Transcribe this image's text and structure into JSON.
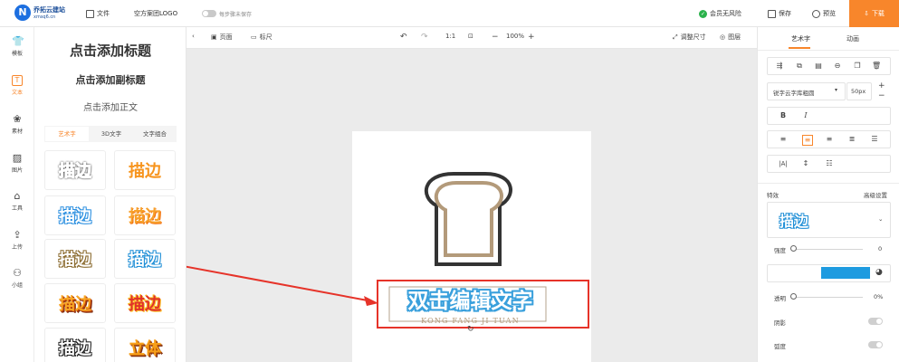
{
  "topbar": {
    "logo_letter": "N",
    "brand_name": "乔拓云建站",
    "brand_domain": "xmsq6.cn",
    "file_label": "文件",
    "blank_template_label": "空方案团LOGO",
    "save_cloud_label": "每步骤未保存",
    "member_label": "会员无风险",
    "save_label": "保存",
    "preview_label": "预览",
    "download_label": "下载"
  },
  "rail": {
    "items": [
      {
        "label": "模板",
        "icon": "shirt-icon",
        "glyph": "👕"
      },
      {
        "label": "文本",
        "icon": "text-icon",
        "glyph": "T"
      },
      {
        "label": "素材",
        "icon": "material-icon",
        "glyph": "❀"
      },
      {
        "label": "图片",
        "icon": "image-icon",
        "glyph": "▨"
      },
      {
        "label": "工具",
        "icon": "toolbox-icon",
        "glyph": "⌂"
      },
      {
        "label": "上传",
        "icon": "upload-icon",
        "glyph": "⇪"
      },
      {
        "label": "小组",
        "icon": "group-icon",
        "glyph": "⚇"
      }
    ]
  },
  "text_panel": {
    "add_title": "点击添加标题",
    "add_subtitle": "点击添加副标题",
    "add_body": "点击添加正文",
    "tabs": [
      "艺术字",
      "3D文字",
      "文字组合"
    ],
    "swatches": [
      {
        "text": "描边"
      },
      {
        "text": "描边"
      },
      {
        "text": "描边"
      },
      {
        "text": "描边"
      },
      {
        "text": "描边"
      },
      {
        "text": "描边"
      },
      {
        "text": "描边"
      },
      {
        "text": "描边"
      },
      {
        "text": "描边"
      },
      {
        "text": "立体"
      }
    ]
  },
  "canvas_toolbar": {
    "page_label": "页面",
    "ruler_label": "标尺",
    "ratio_label": "1:1",
    "zoom_label": "100%",
    "resize_label": "调整尺寸",
    "layers_label": "图层"
  },
  "canvas": {
    "main_text": "双击编辑文字",
    "sub_text": "KONG FANG JI TUAN",
    "colors": {
      "bread_outer": "#333333",
      "bread_inner": "#b39a7a",
      "highlight": "#e63329",
      "text_fill": "#ffffff",
      "text_stroke": "#3aa0dc"
    }
  },
  "right_panel": {
    "tabs": [
      "艺术字",
      "动画"
    ],
    "font_name": "锐字云字库粗圆",
    "font_size": "50px",
    "effects_label": "特效",
    "advanced_label": "高级设置",
    "preview_text": "描边",
    "intensity_label": "强度",
    "intensity_value": "0",
    "color_hex": "#1e9be0",
    "opacity_label": "透明",
    "opacity_value": "0%",
    "shadow_label": "阴影",
    "curve_label": "弧度"
  }
}
